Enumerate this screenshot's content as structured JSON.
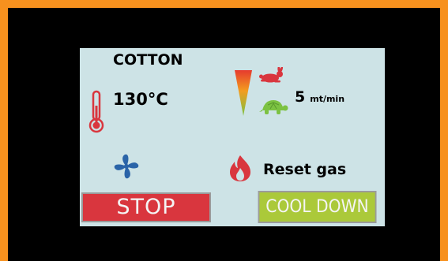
{
  "program": {
    "material": "COTTON",
    "temperature": "130°C"
  },
  "speed": {
    "value": "5",
    "unit": "mt/min"
  },
  "controls": {
    "reset_gas_label": "Reset gas",
    "stop_label": "STOP",
    "cool_down_label": "COOL DOWN"
  },
  "colors": {
    "outer_frame": "#f7911e",
    "bezel": "#000000",
    "screen_background": "#cde3e6",
    "stop_button": "#d9363e",
    "cool_down_button": "#abc93a",
    "thermometer": "#d9363e",
    "fan": "#2a64a8",
    "flame": "#d9363e",
    "rabbit": "#d9363e",
    "turtle": "#7cc242"
  },
  "icons": {
    "thermometer": "thermometer-icon",
    "speed_gauge": "speed-cone-icon",
    "fast": "rabbit-icon",
    "slow": "turtle-icon",
    "fan": "fan-icon",
    "gas": "flame-icon"
  }
}
